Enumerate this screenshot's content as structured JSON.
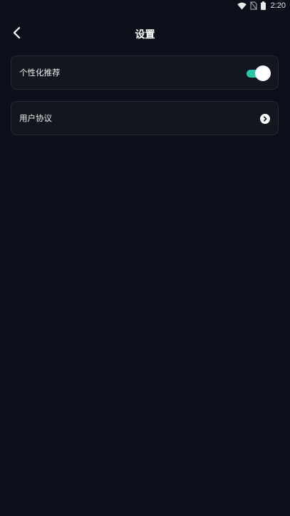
{
  "status_bar": {
    "time": "2:20",
    "icons": [
      "wifi-icon",
      "no-sim-icon",
      "battery-icon"
    ]
  },
  "header": {
    "title": "设置",
    "back_icon": "chevron-left-icon"
  },
  "settings": [
    {
      "label": "个性化推荐",
      "control": "toggle",
      "enabled": true
    },
    {
      "label": "用户协议",
      "control": "chevron-right-circle-icon"
    }
  ],
  "colors": {
    "background": "#0b0f1a",
    "card": "#12161f",
    "toggle_on": "#2ec4a6"
  }
}
